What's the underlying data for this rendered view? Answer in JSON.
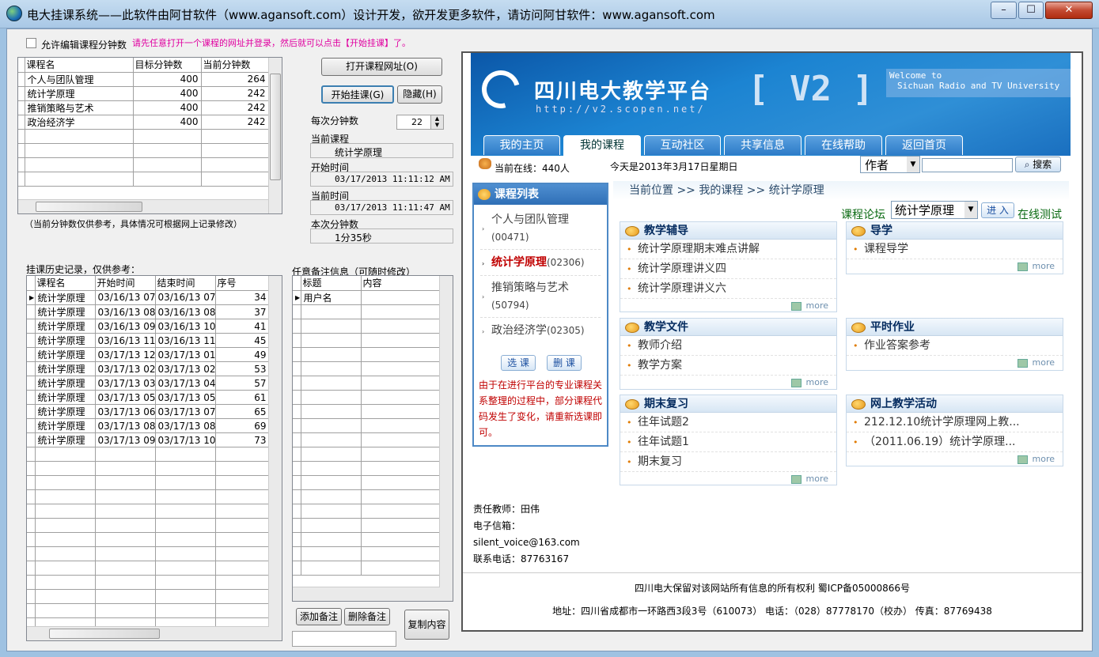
{
  "window": {
    "title": "电大挂课系统——此软件由阿甘软件（www.agansoft.com）设计开发，欲开发更多软件，请访问阿甘软件：www.agansoft.com",
    "min_glyph": "–",
    "max_glyph": "☐",
    "close_glyph": "✕"
  },
  "left": {
    "allow_edit_label": "允许编辑课程分钟数",
    "hint": "请先任意打开一个课程的网址并登录，然后就可以点击【开始挂课】了。",
    "course_grid": {
      "headers": [
        "课程名",
        "目标分钟数",
        "当前分钟数"
      ],
      "rows": [
        [
          "个人与团队管理",
          "400",
          "264"
        ],
        [
          "统计学原理",
          "400",
          "242"
        ],
        [
          "推销策略与艺术",
          "400",
          "242"
        ],
        [
          "政治经济学",
          "400",
          "242"
        ]
      ]
    },
    "note": "（当前分钟数仅供参考，具体情况可根据网上记录修改）",
    "history_label": "挂课历史记录，仅供参考：",
    "history_grid": {
      "headers": [
        "课程名",
        "开始时间",
        "结束时间",
        "序号"
      ],
      "rows": [
        [
          "统计学原理",
          "03/16/13 07:",
          "03/16/13 07:",
          "34"
        ],
        [
          "统计学原理",
          "03/16/13 08:",
          "03/16/13 08:",
          "37"
        ],
        [
          "统计学原理",
          "03/16/13 09:",
          "03/16/13 10:",
          "41"
        ],
        [
          "统计学原理",
          "03/16/13 11:",
          "03/16/13 11:",
          "45"
        ],
        [
          "统计学原理",
          "03/17/13 12:",
          "03/17/13 01:",
          "49"
        ],
        [
          "统计学原理",
          "03/17/13 02:",
          "03/17/13 02:",
          "53"
        ],
        [
          "统计学原理",
          "03/17/13 03:",
          "03/17/13 04:",
          "57"
        ],
        [
          "统计学原理",
          "03/17/13 05:",
          "03/17/13 05:",
          "61"
        ],
        [
          "统计学原理",
          "03/17/13 06:",
          "03/17/13 07:",
          "65"
        ],
        [
          "统计学原理",
          "03/17/13 08:",
          "03/17/13 08:",
          "69"
        ],
        [
          "统计学原理",
          "03/17/13 09:",
          "03/17/13 10:",
          "73"
        ]
      ]
    }
  },
  "middle": {
    "open_url_btn": "打开课程网址(O)",
    "start_btn": "开始挂课(G)",
    "hide_btn": "隐藏(H)",
    "per_minutes_label": "每次分钟数",
    "per_minutes_value": "22",
    "current_course_label": "当前课程",
    "current_course_value": "统计学原理",
    "start_time_label": "开始时间",
    "start_time_value": "03/17/2013 11:11:12 AM",
    "current_time_label": "当前时间",
    "current_time_value": "03/17/2013 11:11:47 AM",
    "this_minutes_label": "本次分钟数",
    "this_minutes_value": "1分35秒",
    "memo_label": "任意备注信息（可随时修改）",
    "memo_headers": [
      "标题",
      "内容"
    ],
    "memo_rows": [
      [
        "用户名",
        ""
      ]
    ],
    "add_memo_btn": "添加备注",
    "delete_memo_btn": "删除备注",
    "copy_btn": "复制内容"
  },
  "site": {
    "logo_cn": "四川电大教学平台",
    "logo_url": "http://v2.scopen.net/",
    "logo_v2": "[ V2 ]",
    "welcome1": "Welcome to",
    "welcome2": "Sichuan Radio and TV University",
    "nav": [
      "我的主页",
      "我的课程",
      "互动社区",
      "共享信息",
      "在线帮助",
      "返回首页"
    ],
    "online": "当前在线：440人",
    "today": "今天是2013年3月17日星期日",
    "search_select": "作者",
    "search_btn": "搜索",
    "course_list_title": "课程列表",
    "course_list": [
      {
        "name": "个人与团队管理",
        "code": "(00471)"
      },
      {
        "name": "统计学原理",
        "code": "(02306)"
      },
      {
        "name": "推销策略与艺术",
        "code": "(50794)"
      },
      {
        "name": "政治经济学",
        "code": "(02305)"
      }
    ],
    "select_course_btn": "选 课",
    "delete_course_btn": "删 课",
    "notice": "由于在进行平台的专业课程关系整理的过程中，部分课程代码发生了变化，请重新选课即可。",
    "breadcrumb": "当前位置 >> 我的课程 >> 统计学原理",
    "forum_label": "课程论坛",
    "forum_select": "统计学原理",
    "enter_btn": "进 入",
    "online_test": "在线测试",
    "sections": [
      {
        "title": "教学辅导",
        "items": [
          "统计学原理期末难点讲解",
          "统计学原理讲义四",
          "统计学原理讲义六"
        ]
      },
      {
        "title": "导学",
        "items": [
          "课程导学"
        ]
      },
      {
        "title": "教学文件",
        "items": [
          "教师介绍",
          "教学方案"
        ]
      },
      {
        "title": "平时作业",
        "items": [
          "作业答案参考"
        ]
      },
      {
        "title": "期末复习",
        "items": [
          "往年试题2",
          "往年试题1",
          "期末复习"
        ]
      },
      {
        "title": "网上教学活动",
        "items": [
          "212.12.10统计学原理网上教...",
          "（2011.06.19）统计学原理..."
        ]
      }
    ],
    "more": "more",
    "teacher": "责任教师：田伟",
    "email_label": "电子信箱：",
    "email": "silent_voice@163.com",
    "phone": "联系电话：87763167",
    "copyright": "四川电大保留对该网站所有信息的所有权利 蜀ICP备05000866号",
    "address": "地址：四川省成都市一环路西3段3号（610073） 电话：（028）87778170（校办） 传真：87769438"
  },
  "colors": {
    "accent": "#e000a0",
    "link_red": "#c00000",
    "link_green": "#0a6a12",
    "nav_blue": "#2d7bc8"
  }
}
